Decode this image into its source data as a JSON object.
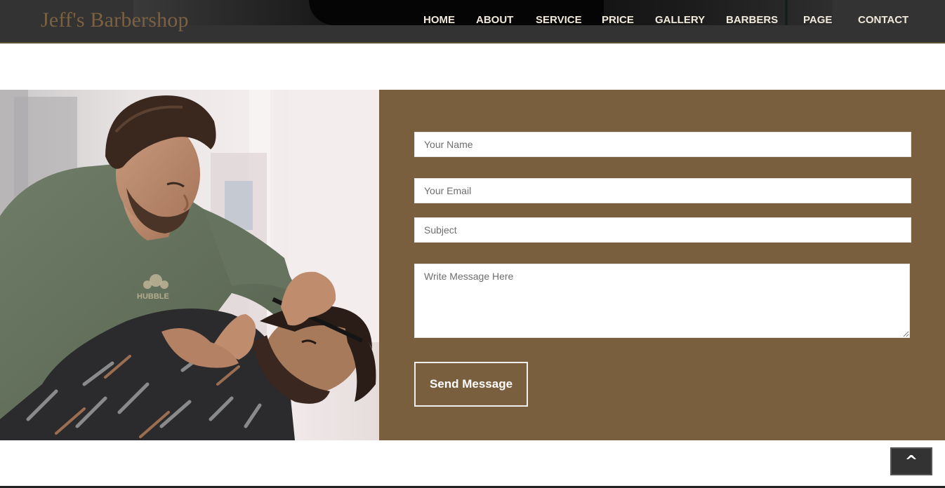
{
  "header": {
    "logo": "Jeff's Barbershop",
    "nav": [
      {
        "label": "HOME"
      },
      {
        "label": "ABOUT"
      },
      {
        "label": "SERVICE"
      },
      {
        "label": "PRICE"
      },
      {
        "label": "GALLERY"
      },
      {
        "label": "BARBERS"
      },
      {
        "label": "PAGE"
      },
      {
        "label": "CONTACT"
      }
    ]
  },
  "contact_form": {
    "name_placeholder": "Your Name",
    "email_placeholder": "Your Email",
    "subject_placeholder": "Subject",
    "message_placeholder": "Write Message Here",
    "submit_label": "Send Message"
  },
  "photo": {
    "shirt_print": "HUBBLE"
  },
  "back_to_top": {
    "label": "^"
  },
  "colors": {
    "header_bg": "#333333",
    "logo": "#7c6141",
    "nav_text": "#f1e9da",
    "form_panel_bg": "#7a5f3f",
    "button_border": "#eeeeee"
  }
}
